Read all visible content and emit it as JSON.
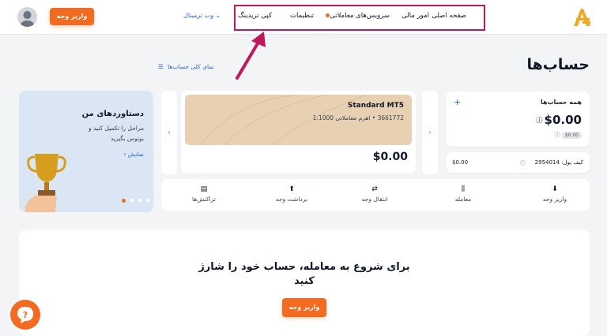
{
  "header": {
    "nav": {
      "home": "صفحه اصلی",
      "finance": "امور مالی",
      "trading_services": "سرویس‌های معاملاتی",
      "settings": "تنظیمات",
      "copy_trading": "کپی تریدینگ"
    },
    "web_terminal": "وب ترمینال",
    "deposit_button": "واریز وجه"
  },
  "page": {
    "title": "حساب‌ها",
    "overview_link": "نمای کلی حساب‌ها"
  },
  "all_accounts": {
    "title": "همه حساب‌ها",
    "add": "+",
    "balance": "$0.00",
    "sub_balance": "$0.00",
    "wallet_label": "کیف پول: 2954014",
    "wallet_value": "$0.00"
  },
  "account": {
    "name": "Standard MT5",
    "details": "3661772 • اهرم معاملاتی 1:1000",
    "balance": "$0.00"
  },
  "actions": {
    "deposit": "واریز وجه",
    "trade": "معامله",
    "transfer": "انتقال وجه",
    "withdraw": "برداشت وجه",
    "transactions": "تراکنش‌ها"
  },
  "achievements": {
    "title": "دستاوردهای من",
    "text_line1": "مراحل را تکمیل کنید و",
    "text_line2": "بونوس بگیرید",
    "link": "نمایش"
  },
  "cta": {
    "line1": "برای شروع به معامله، حساب خود را شارژ",
    "line2": "کنید",
    "button": "واریز وجه"
  },
  "colors": {
    "accent": "#f26b21",
    "link": "#2563eb",
    "highlight_box": "#c2185b",
    "account_card": "#e8d1b3",
    "achievements_bg": "#dbe6f5"
  }
}
